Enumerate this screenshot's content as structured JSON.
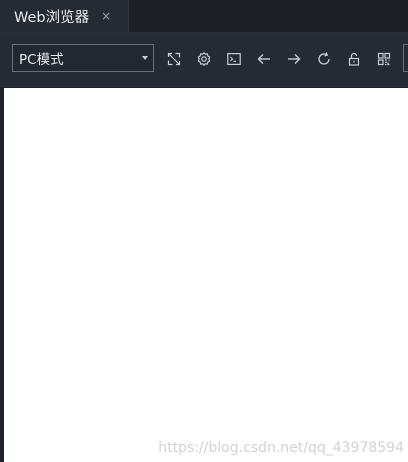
{
  "tabbar": {
    "tab_title": "Web浏览器",
    "close_glyph": "×"
  },
  "toolbar": {
    "mode_select": {
      "value": "PC模式"
    },
    "tools": [
      {
        "icon": "expand-icon"
      },
      {
        "icon": "gear-icon"
      },
      {
        "icon": "console-icon"
      },
      {
        "icon": "back-arrow-icon"
      },
      {
        "icon": "forward-arrow-icon"
      },
      {
        "icon": "refresh-icon"
      },
      {
        "icon": "unlock-icon"
      },
      {
        "icon": "qr-code-icon"
      }
    ]
  },
  "content": {
    "watermark": "https://blog.csdn.net/qq_43978594"
  },
  "colors": {
    "chrome": "#262a33",
    "icon": "#c9cdd4",
    "page": "#ffffff"
  }
}
